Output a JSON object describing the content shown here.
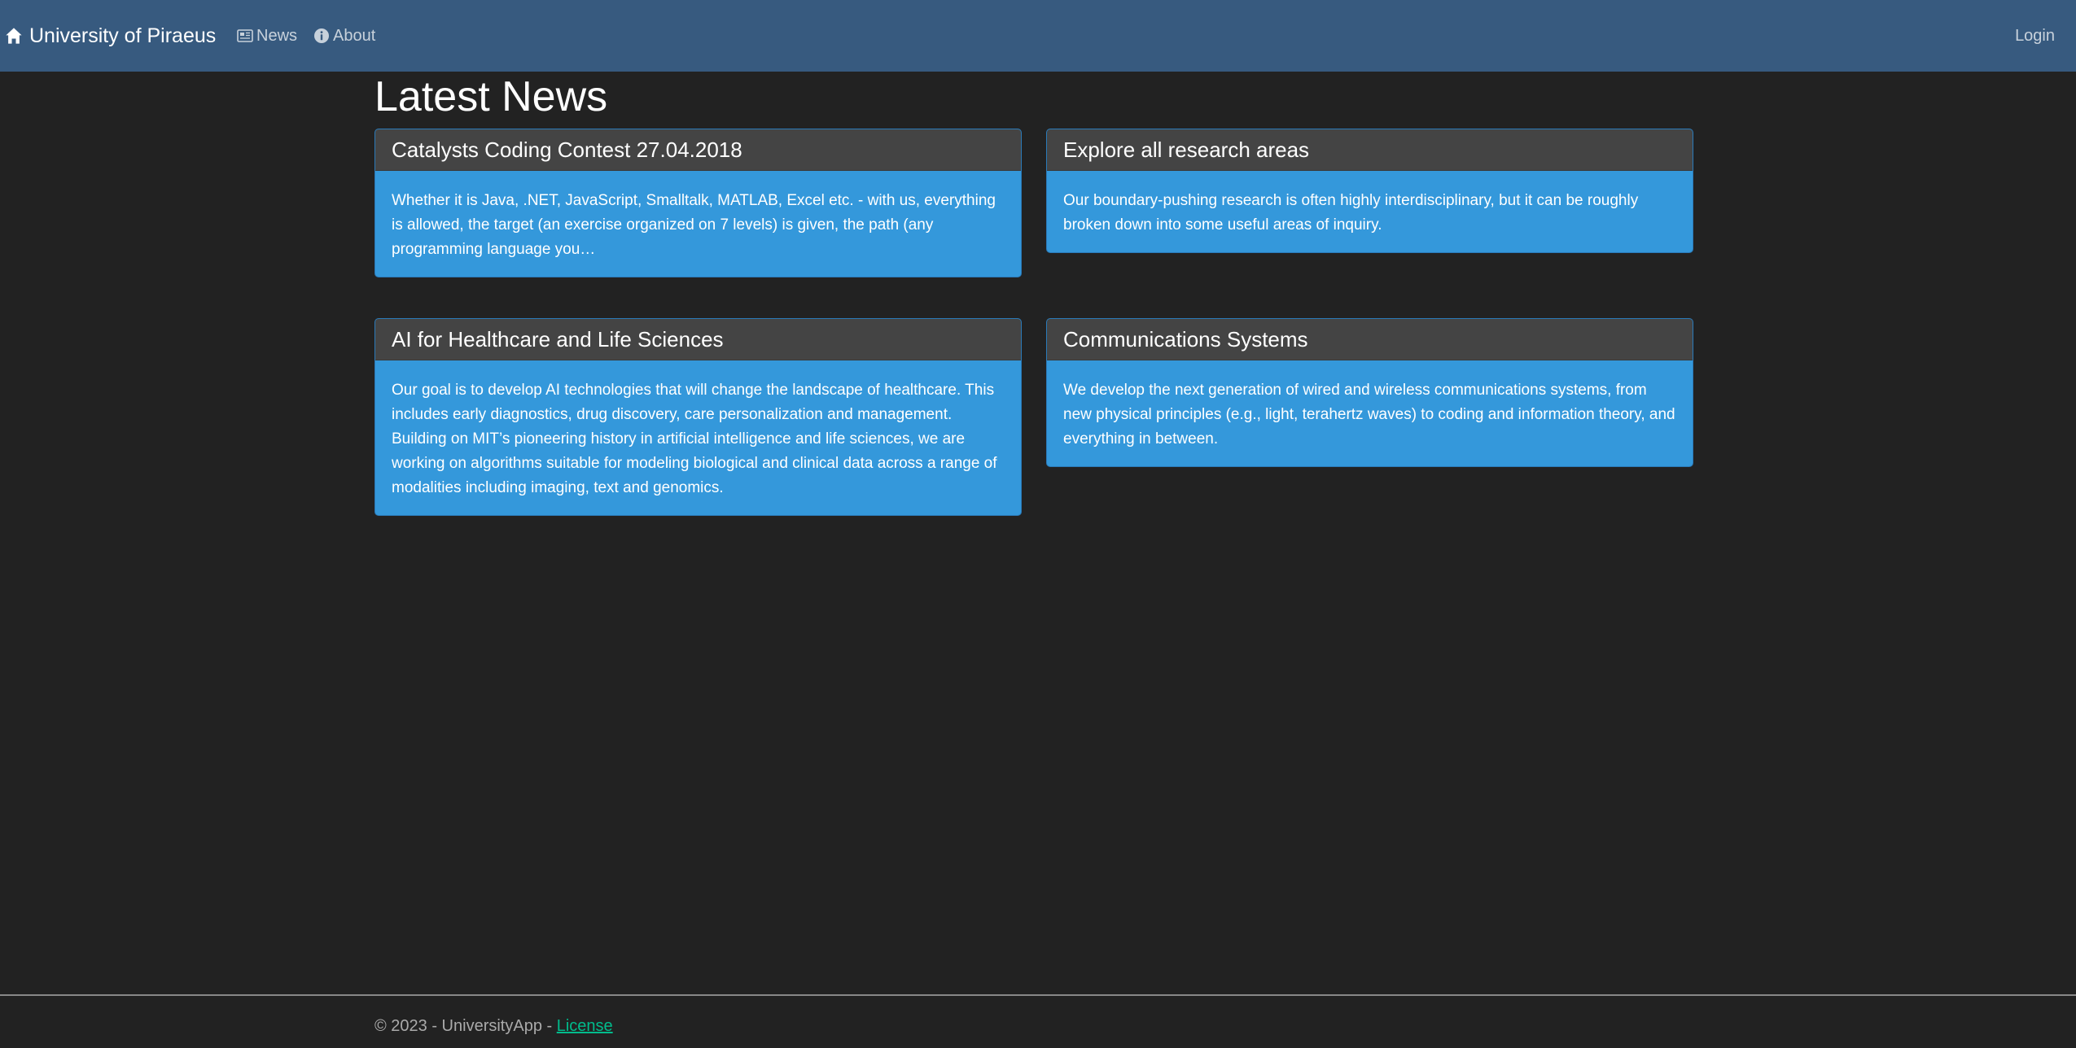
{
  "navbar": {
    "brand": "University of Piraeus",
    "links": [
      {
        "label": "News",
        "icon": "newspaper-icon"
      },
      {
        "label": "About",
        "icon": "info-circle-icon"
      }
    ],
    "login": "Login",
    "color": "#375a7f"
  },
  "main": {
    "title": "Latest News",
    "cards": [
      {
        "title": "Catalysts Coding Contest 27.04.2018",
        "body": "Whether it is Java, .NET, JavaScript, Smalltalk, MATLAB, Excel etc. - with us, everything is allowed, the target (an exercise organized on 7 levels) is given, the path (any programming language you…"
      },
      {
        "title": "Explore all research areas",
        "body": "Our boundary-pushing research is often highly interdisciplinary, but it can be roughly broken down into some useful areas of inquiry."
      },
      {
        "title": "AI for Healthcare and Life Sciences",
        "body": "Our goal is to develop AI technologies that will change the landscape of healthcare. This includes early diagnostics, drug discovery, care personalization and management. Building on MIT’s pioneering history in artificial intelligence and life sciences, we are working on algorithms suitable for modeling biological and clinical data across a range of modalities including imaging, text and genomics."
      },
      {
        "title": "Communications Systems",
        "body": "We develop the next generation of wired and wireless communications systems, from new physical principles (e.g., light, terahertz waves) to coding and information theory, and everything in between."
      }
    ],
    "card_color": "#3498db",
    "card_header_color": "#444444"
  },
  "footer": {
    "text": "© 2023 - UniversityApp - ",
    "link": "License",
    "link_color": "#00bc8c"
  }
}
